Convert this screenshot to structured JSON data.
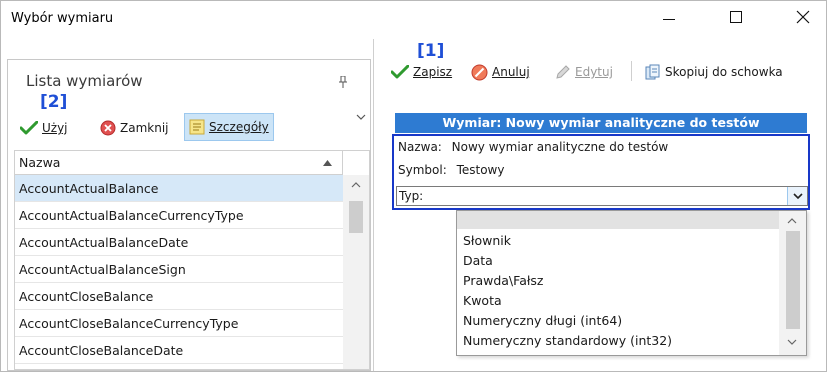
{
  "window": {
    "title": "Wybór wymiaru"
  },
  "left_pane": {
    "title": "Lista wymiarów",
    "marker": "[2]",
    "toolbar": {
      "use_label": "Użyj",
      "close_label": "Zamknij",
      "details_label": "Szczegóły"
    },
    "grid": {
      "column_header": "Nazwa",
      "rows": [
        "AccountActualBalance",
        "AccountActualBalanceCurrencyType",
        "AccountActualBalanceDate",
        "AccountActualBalanceSign",
        "AccountCloseBalance",
        "AccountCloseBalanceCurrencyType",
        "AccountCloseBalanceDate"
      ],
      "selected_index": 0
    }
  },
  "right_pane": {
    "marker": "[1]",
    "toolbar": {
      "save_label": "Zapisz",
      "cancel_label": "Anuluj",
      "edit_label": "Edytuj",
      "copy_label": "Skopiuj do schowka"
    },
    "form": {
      "header": "Wymiar: Nowy wymiar analityczne do testów",
      "name_label": "Nazwa:",
      "name_value": "Nowy wymiar analityczne do testów",
      "symbol_label": "Symbol:",
      "symbol_value": "Testowy",
      "type_label": "Typ:"
    },
    "type_dropdown": {
      "options": [
        "",
        "Słownik",
        "Data",
        "Prawda\\Fałsz",
        "Kwota",
        "Numeryczny długi (int64)",
        "Numeryczny standardowy (int32)"
      ]
    }
  },
  "colors": {
    "accent_blue": "#2e7bd2",
    "highlight_border": "#1838c8",
    "marker_blue": "#1f4fd6",
    "selection": "#d6e8f8"
  }
}
